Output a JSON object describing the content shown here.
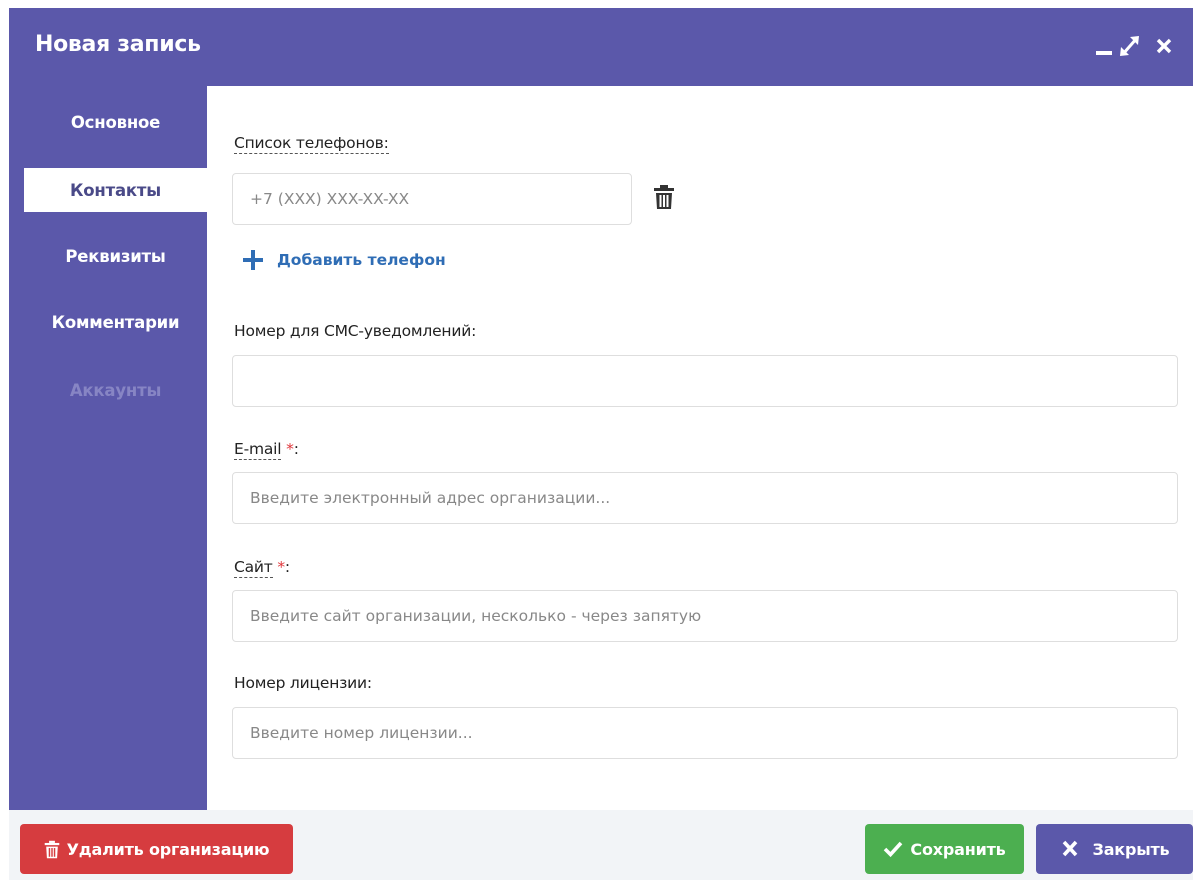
{
  "dialog": {
    "title": "Новая запись",
    "controls": [
      "minimize-icon",
      "maximize-icon",
      "close-icon"
    ]
  },
  "sidebar": {
    "items": [
      {
        "label": "Основное",
        "state": "normal"
      },
      {
        "label": "Контакты",
        "state": "active"
      },
      {
        "label": "Реквизиты",
        "state": "normal"
      },
      {
        "label": "Комментарии",
        "state": "normal"
      },
      {
        "label": "Аккаунты",
        "state": "disabled"
      }
    ]
  },
  "form": {
    "phones": {
      "label": "Список телефонов:",
      "placeholder": "+7 (XXX) XXX-XX-XX",
      "value": "",
      "delete_icon": "trash-icon",
      "add_label": "Добавить телефон"
    },
    "sms": {
      "label": "Номер для СМС-уведомлений:",
      "placeholder": "",
      "value": ""
    },
    "email": {
      "label": "E-mail",
      "required_mark": "*",
      "suffix": ":",
      "placeholder": "Введите электронный адрес организации...",
      "value": ""
    },
    "site": {
      "label": "Сайт",
      "required_mark": "*",
      "suffix": ":",
      "placeholder": "Введите сайт организации, несколько - через запятую",
      "value": ""
    },
    "license": {
      "label": "Номер лицензии:",
      "placeholder": "Введите номер лицензии...",
      "value": ""
    }
  },
  "footer": {
    "delete_label": "Удалить организацию",
    "save_label": "Сохранить",
    "close_label": "Закрыть"
  },
  "colors": {
    "primary": "#5b58aa",
    "danger": "#d63c3f",
    "success": "#4caf50",
    "link": "#2f6db5",
    "required": "#e0373c"
  }
}
